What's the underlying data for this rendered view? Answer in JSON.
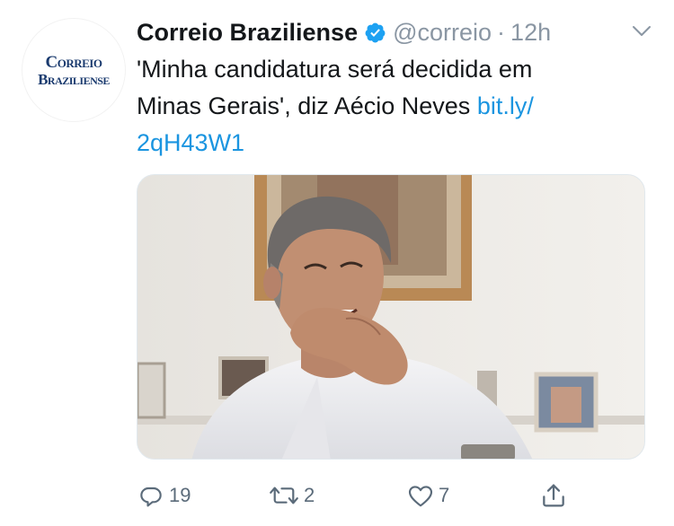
{
  "account": {
    "logo_line1": "Correio",
    "logo_line2": "Braziliense",
    "name": "Correio Braziliense",
    "handle": "@correio",
    "separator": "·",
    "time": "12h"
  },
  "tweet": {
    "line1": "'Minha candidatura será decidida em",
    "line2_text": "Minas Gerais', diz Aécio Neves ",
    "link_part1": "bit.ly/",
    "link_part2": "2qH43W1"
  },
  "actions": {
    "reply_count": "19",
    "retweet_count": "2",
    "like_count": "7"
  },
  "icons": {
    "verified": "verified-badge-icon",
    "caret": "chevron-down-icon",
    "reply": "reply-icon",
    "retweet": "retweet-icon",
    "like": "heart-icon",
    "share": "share-icon"
  },
  "colors": {
    "link": "#1b95e0",
    "meta": "#8a96a3",
    "verified": "#1da1f2"
  }
}
